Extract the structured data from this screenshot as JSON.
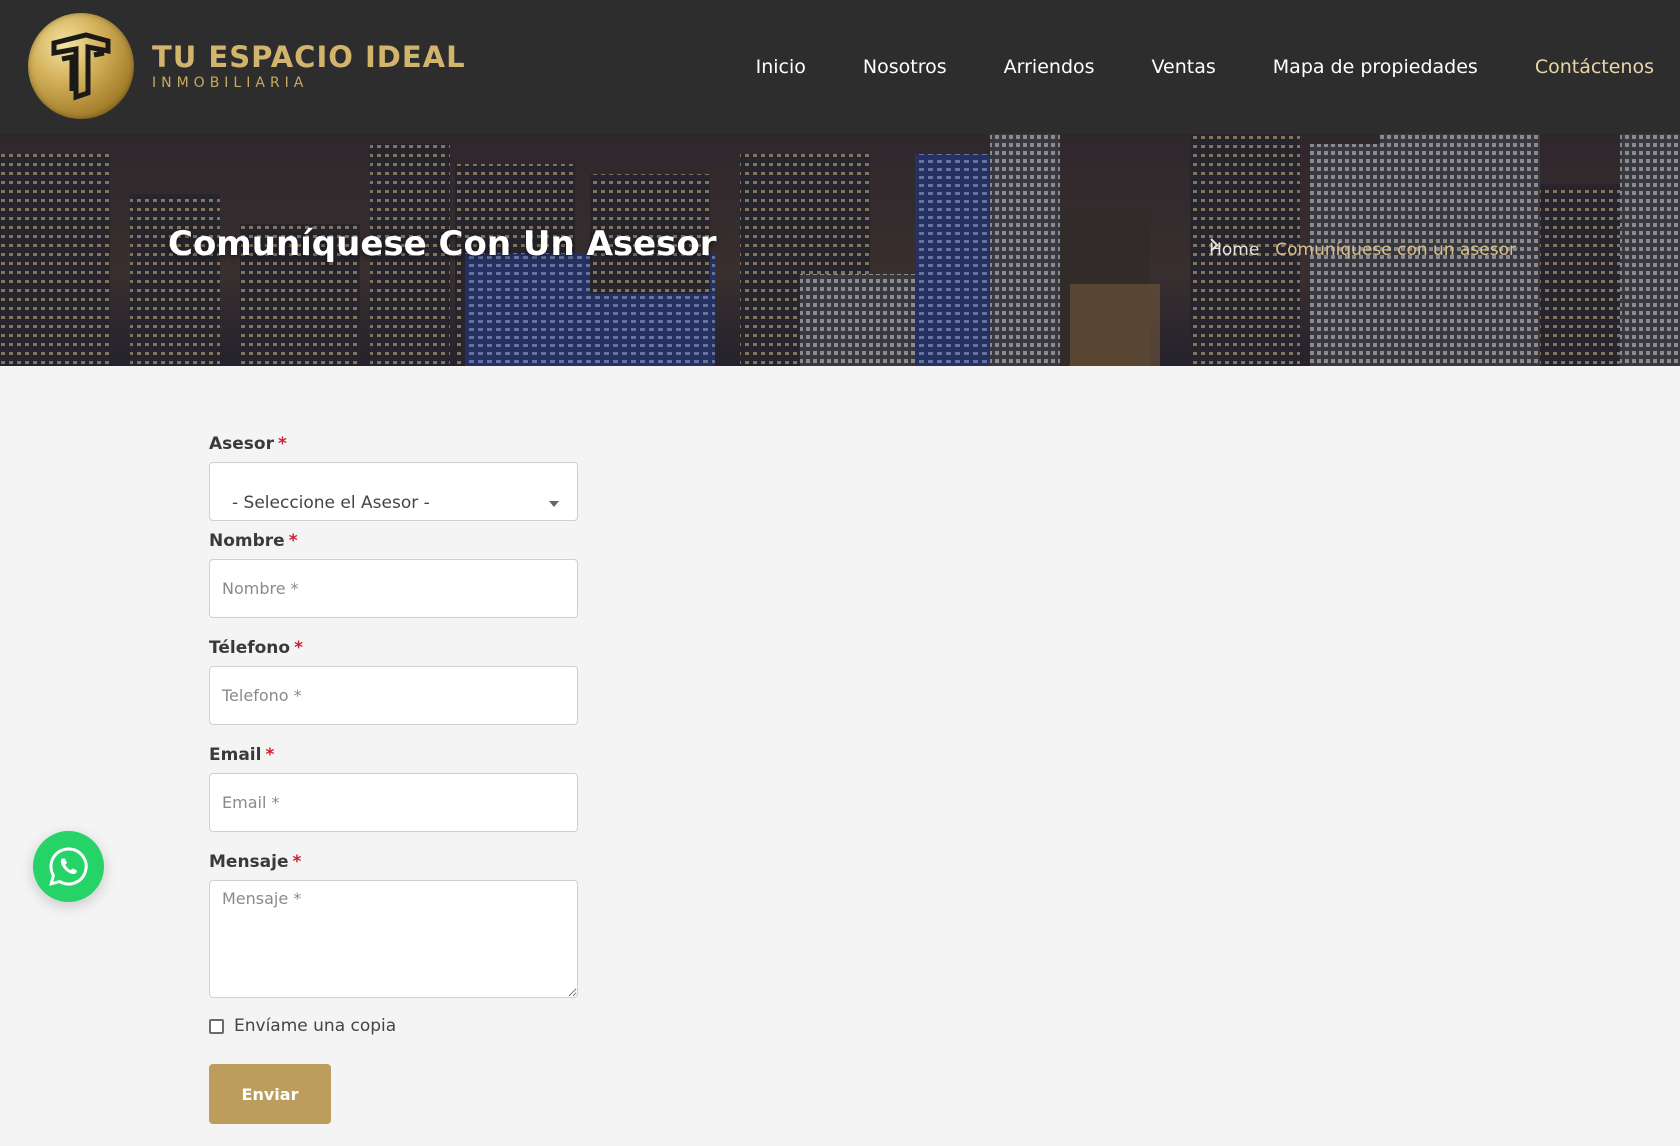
{
  "brand": {
    "name": "TU ESPACIO IDEAL",
    "tagline": "INMOBILIARIA"
  },
  "nav": {
    "items": [
      {
        "label": "Inicio",
        "active": false
      },
      {
        "label": "Nosotros",
        "active": false
      },
      {
        "label": "Arriendos",
        "active": false
      },
      {
        "label": "Ventas",
        "active": false
      },
      {
        "label": "Mapa de propiedades",
        "active": false
      },
      {
        "label": "Contáctenos",
        "active": true
      }
    ]
  },
  "hero": {
    "title": "Comuníquese Con Un Asesor",
    "breadcrumb": {
      "home": "Home",
      "separator_icon": "chevron-right-icon",
      "current": "Comuníquese con un asesor"
    }
  },
  "form": {
    "asesor": {
      "label": "Asesor",
      "required_mark": "*",
      "selected": "- Seleccione el Asesor -"
    },
    "nombre": {
      "label": "Nombre",
      "required_mark": "*",
      "placeholder": "Nombre *"
    },
    "telefono": {
      "label": "Télefono",
      "required_mark": "*",
      "placeholder": "Telefono *"
    },
    "email": {
      "label": "Email",
      "required_mark": "*",
      "placeholder": "Email *"
    },
    "mensaje": {
      "label": "Mensaje",
      "required_mark": "*",
      "placeholder": "Mensaje *"
    },
    "copy_checkbox": {
      "label": "Envíame una copia",
      "checked": false
    },
    "submit_label": "Enviar"
  },
  "colors": {
    "header_bg": "#2d2d2d",
    "gold_accent": "#bc9d5d",
    "required": "#d2202f",
    "whatsapp": "#25d366",
    "page_bg": "#f4f4f4"
  },
  "icons": {
    "whatsapp": "whatsapp-icon",
    "select_caret": "chevron-down-icon"
  }
}
